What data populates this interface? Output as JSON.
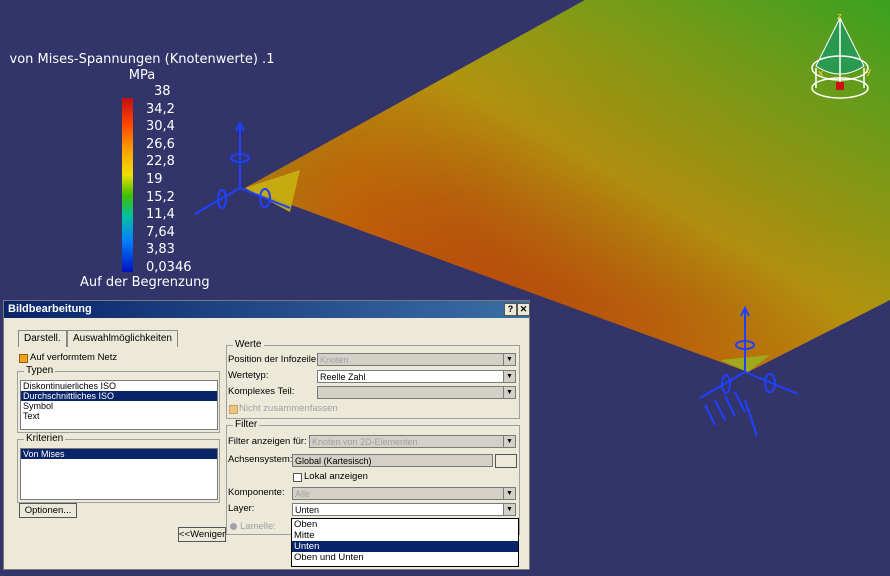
{
  "legend": {
    "title": "von Mises-Spannungen (Knotenwerte) .1",
    "unit": "MPa",
    "ticks": [
      "38",
      "34,2",
      "30,4",
      "26,6",
      "22,8",
      "19",
      "15,2",
      "11,4",
      "7,64",
      "3,83",
      "0,0346"
    ],
    "footer": "Auf der Begrenzung"
  },
  "dialog": {
    "title": "Bildbearbeitung",
    "help": "?",
    "close": "✕",
    "tabs": [
      "Darstell.",
      "Auswahlmöglichkeiten"
    ],
    "deformed_mesh": "Auf verformtem Netz",
    "types_label": "Typen",
    "types": [
      "Diskontinuierliches ISO",
      "Durchschnittliches ISO",
      "Symbol",
      "Text"
    ],
    "criteria_label": "Kriterien",
    "criteria": [
      "Von Mises"
    ],
    "options_button": "Optionen...",
    "less_button": "<<Weniger",
    "values_label": "Werte",
    "info_position_label": "Position der Infozeile",
    "info_position_value": "Knoten",
    "value_type_label": "Wertetyp:",
    "value_type_value": "Reelle Zahl",
    "complex_part_label": "Komplexes Teil:",
    "complex_part_value": "",
    "no_combine": "Nicht zusammenfassen",
    "filter_label": "Filter",
    "filter_for_label": "Filter anzeigen für:",
    "filter_for_value": "Knoten von 2D-Elementen",
    "axis_label": "Achsensystem:",
    "axis_value": "Global (Kartesisch)",
    "local_display": "Lokal anzeigen",
    "component_label": "Komponente:",
    "component_value": "Alle",
    "layer_label": "Layer:",
    "layer_value": "Unten",
    "lamella_label": "Lamelle:",
    "layer_options": [
      "Oben",
      "Mitte",
      "Unten",
      "Oben und Unten"
    ]
  },
  "compass": {
    "z": "z",
    "x": "x",
    "y": "y"
  }
}
